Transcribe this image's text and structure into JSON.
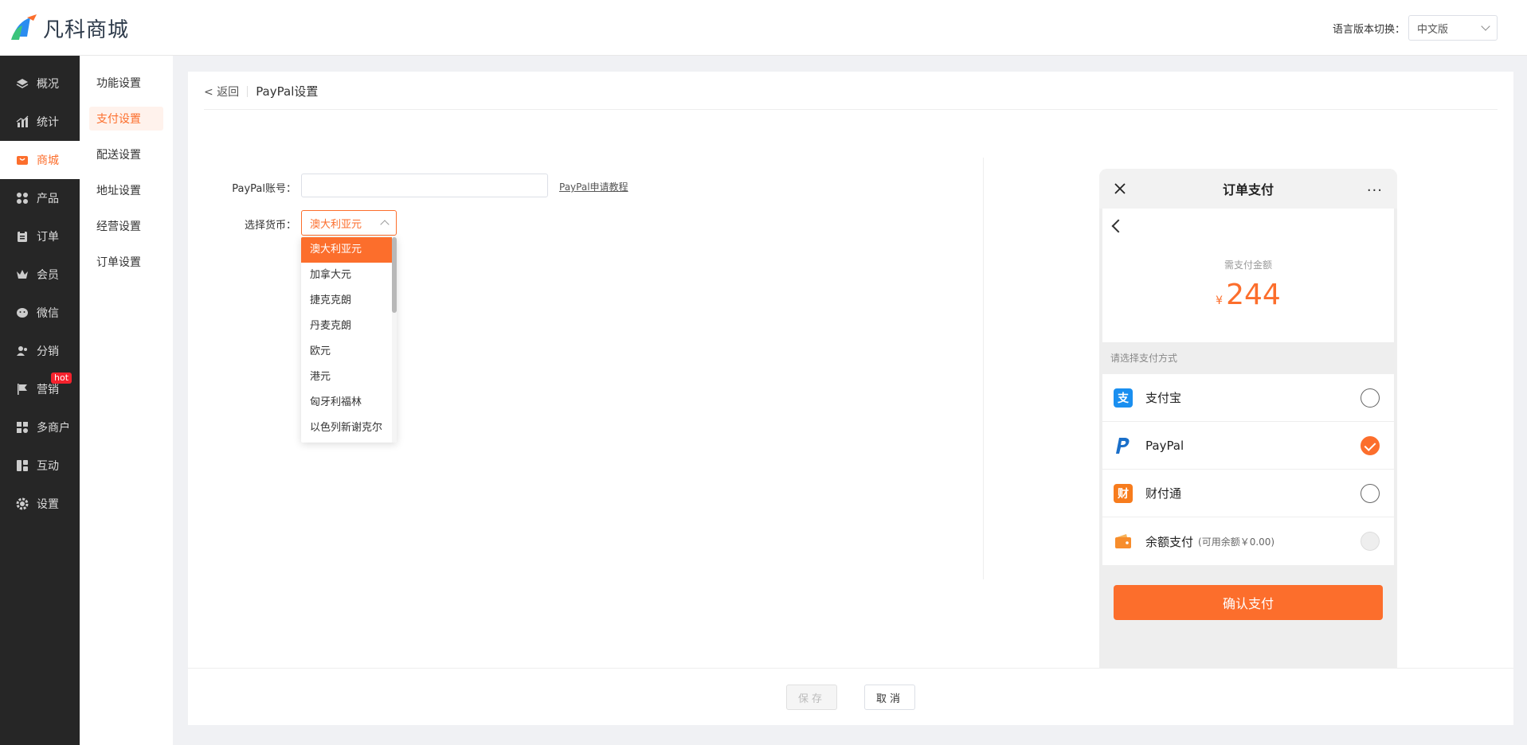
{
  "header": {
    "brand": "凡科商城",
    "lang_label": "语言版本切换：",
    "lang_value": "中文版"
  },
  "sidebar": {
    "items": [
      {
        "label": "概况",
        "icon": "layers-icon"
      },
      {
        "label": "统计",
        "icon": "chart-icon"
      },
      {
        "label": "商城",
        "icon": "store-icon"
      },
      {
        "label": "产品",
        "icon": "grid-icon"
      },
      {
        "label": "订单",
        "icon": "clipboard-icon"
      },
      {
        "label": "会员",
        "icon": "crown-icon"
      },
      {
        "label": "微信",
        "icon": "wechat-icon"
      },
      {
        "label": "分销",
        "icon": "users-icon"
      },
      {
        "label": "营销",
        "icon": "flag-icon"
      },
      {
        "label": "多商户",
        "icon": "shops-icon"
      },
      {
        "label": "互动",
        "icon": "blocks-icon"
      },
      {
        "label": "设置",
        "icon": "gear-icon"
      }
    ],
    "hot_badge": "hot"
  },
  "subbar": {
    "items": [
      "功能设置",
      "支付设置",
      "配送设置",
      "地址设置",
      "经营设置",
      "订单设置"
    ]
  },
  "page": {
    "back": "< 返回",
    "title": "PayPal设置",
    "account_label": "PayPal账号：",
    "account_value": "",
    "tutorial_link": "PayPal申请教程",
    "currency_label": "选择货币：",
    "currency_value": "澳大利亚元",
    "currency_options": [
      "澳大利亚元",
      "加拿大元",
      "捷克克朗",
      "丹麦克朗",
      "欧元",
      "港元",
      "匈牙利福林",
      "以色列新谢克尔"
    ]
  },
  "phone": {
    "title": "订单支付",
    "more": "···",
    "amount_label": "需支付金额",
    "currency_symbol": "¥",
    "amount": "244",
    "method_label": "请选择支付方式",
    "methods": [
      {
        "name": "支付宝",
        "sub": "",
        "state": "unchecked"
      },
      {
        "name": "PayPal",
        "sub": "",
        "state": "checked"
      },
      {
        "name": "财付通",
        "sub": "",
        "state": "unchecked"
      },
      {
        "name": "余额支付",
        "sub": "(可用余额￥0.00)",
        "state": "disabled"
      }
    ],
    "confirm": "确认支付"
  },
  "footer": {
    "save": "保存",
    "cancel": "取消"
  },
  "colors": {
    "accent": "#fc6e2c",
    "sidebar_bg": "#262626"
  }
}
